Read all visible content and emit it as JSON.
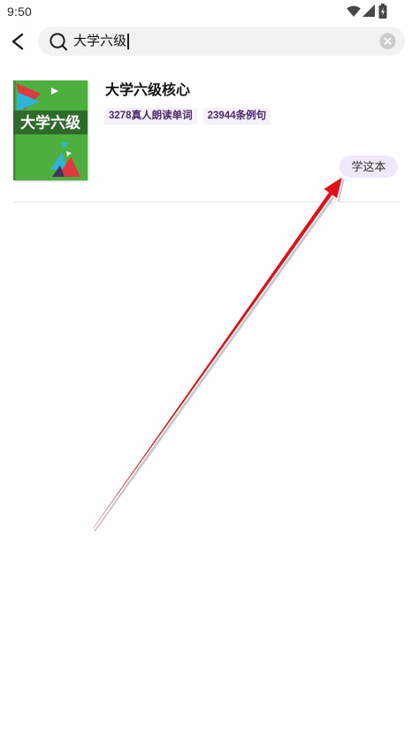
{
  "status_bar": {
    "time": "9:50",
    "icons": [
      "wifi-icon",
      "cellular-signal-icon",
      "battery-icon"
    ]
  },
  "search": {
    "query": "大学六级",
    "icons": {
      "back": "back-arrow-icon",
      "search": "search-icon",
      "clear": "clear-icon"
    }
  },
  "results": [
    {
      "title": "大学六级核心",
      "cover_text": "大学六级",
      "tags": [
        "3278真人朗读单词",
        "23944条例句"
      ],
      "action_label": "学这本"
    }
  ],
  "colors": {
    "background": "#ffffff",
    "search_bg": "#f2f2f2",
    "tag_bg": "#f4f1f7",
    "tag_text": "#4b2a6e",
    "action_button_bg": "#efe8fa",
    "cover_green": "#4caf3e",
    "cover_band": "#2e6b2a",
    "annotation_arrow": "#e60f19"
  }
}
